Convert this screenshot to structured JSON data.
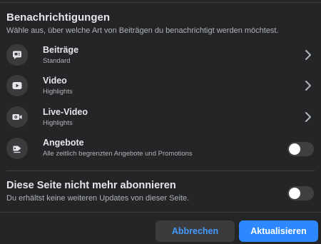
{
  "header": {
    "title": "Benachrichtigungen",
    "description": "Wähle aus, über welche Art von Beiträgen du benachrichtigt werden möchtest."
  },
  "options": [
    {
      "label": "Beiträge",
      "sublabel": "Standard",
      "icon": "posts-icon",
      "control": "chevron"
    },
    {
      "label": "Video",
      "sublabel": "Highlights",
      "icon": "video-play-icon",
      "control": "chevron"
    },
    {
      "label": "Live-Video",
      "sublabel": "Highlights",
      "icon": "live-video-icon",
      "control": "chevron"
    },
    {
      "label": "Angebote",
      "sublabel": "Alle zeitlich begrenzten Angebote und Promotions",
      "icon": "offers-icon",
      "control": "toggle",
      "enabled": false
    }
  ],
  "unsubscribe": {
    "title": "Diese Seite nicht mehr abonnieren",
    "description": "Du erhältst keine weiteren Updates von dieser Seite.",
    "enabled": false
  },
  "footer": {
    "cancel_label": "Abbrechen",
    "update_label": "Aktualisieren"
  },
  "colors": {
    "background": "#242526",
    "accent": "#2d88ff",
    "cancel_text": "#4599ff",
    "secondary_text": "#b0b3b8"
  }
}
